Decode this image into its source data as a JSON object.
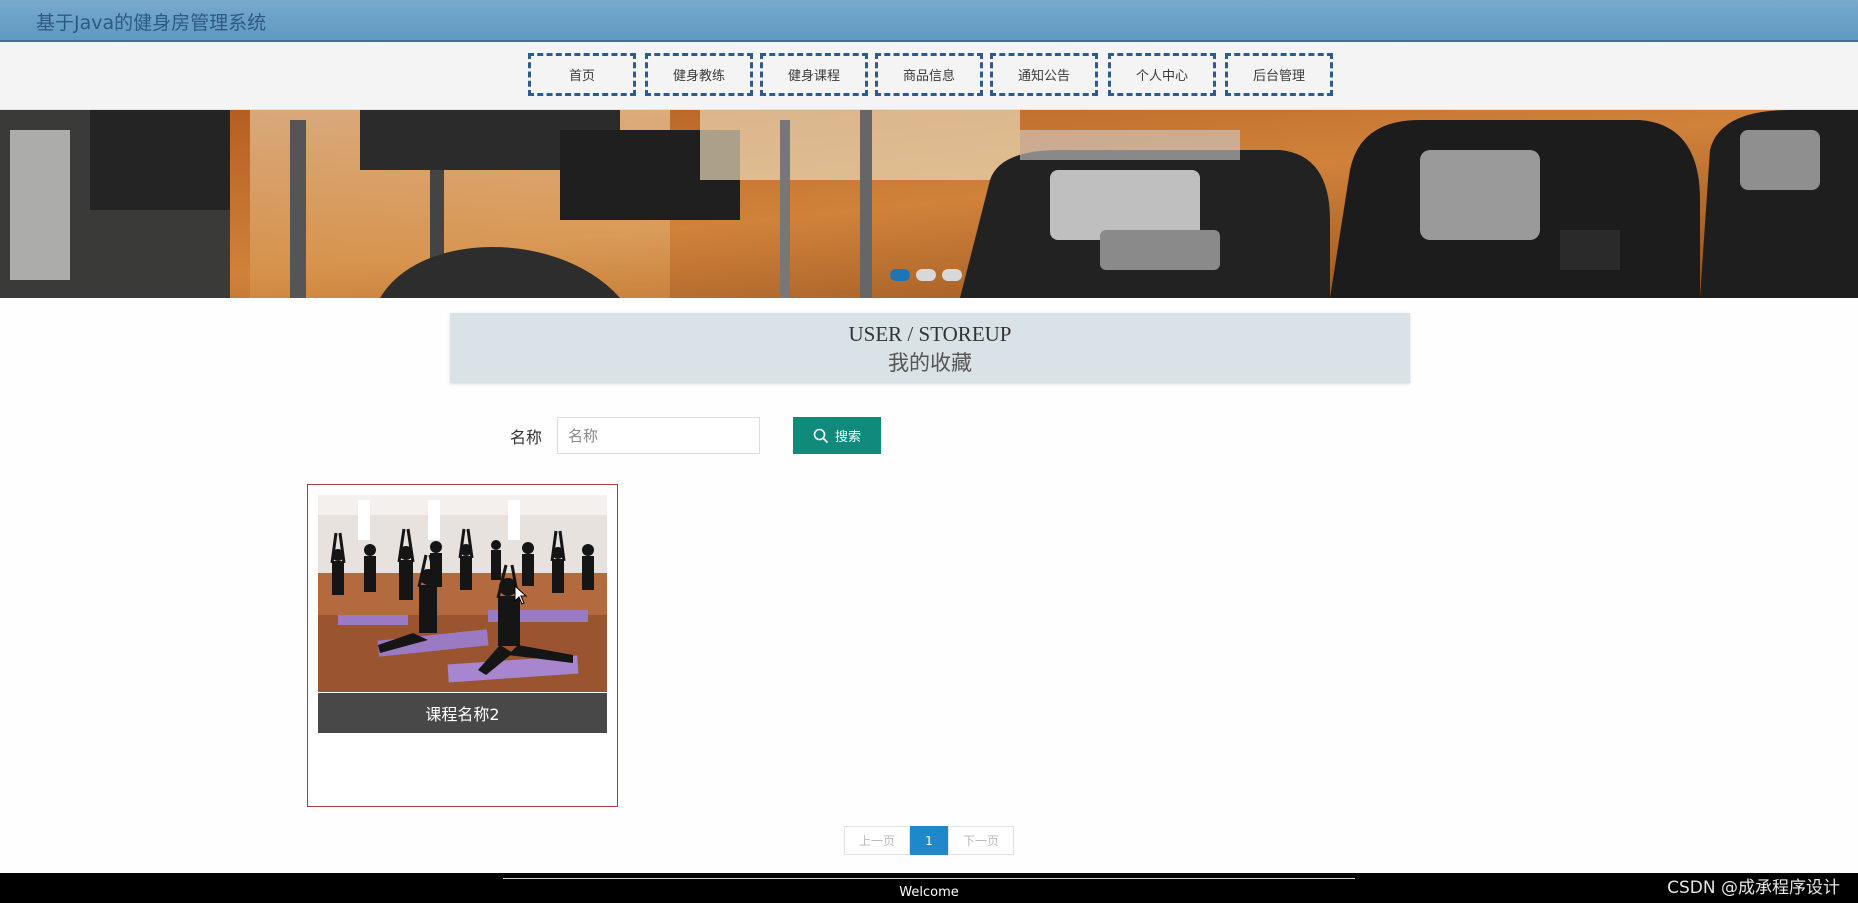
{
  "header": {
    "title": "基于Java的健身房管理系统"
  },
  "nav": {
    "items": [
      "首页",
      "健身教练",
      "健身课程",
      "商品信息",
      "通知公告",
      "个人中心",
      "后台管理"
    ]
  },
  "banner": {
    "dots": 3,
    "active_index": 0
  },
  "section": {
    "title_en": "USER / STOREUP",
    "title_cn": "我的收藏"
  },
  "search": {
    "label": "名称",
    "placeholder": "名称",
    "value": "",
    "button_label": "搜索",
    "icon": "search-icon"
  },
  "items": [
    {
      "name": "课程名称2"
    }
  ],
  "pagination": {
    "prev": "上一页",
    "current": "1",
    "next": "下一页"
  },
  "footer": {
    "text": "Welcome"
  },
  "watermark": {
    "text": "CSDN @成承程序设计"
  },
  "colors": {
    "header": "#6aa3c9",
    "nav_border": "#2f5a8e",
    "search_button": "#0f8a7b",
    "card_border": "#b03a44",
    "pager_active": "#1e88c9"
  }
}
